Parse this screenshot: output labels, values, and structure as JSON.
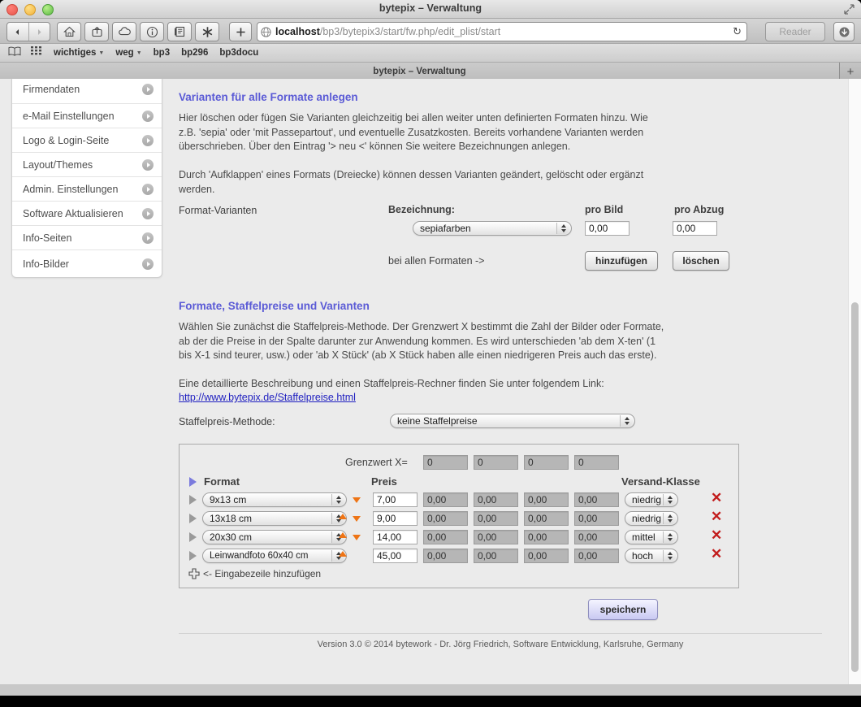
{
  "window": {
    "title": "bytepix – Verwaltung",
    "traffic_lights": [
      "close",
      "minimize",
      "zoom"
    ],
    "expand_icon": "expand-arrows-icon"
  },
  "toolbar": {
    "back_icon": "back-arrow-icon",
    "forward_icon": "forward-arrow-icon",
    "home_icon": "home-icon",
    "share_icon": "share-icon",
    "icloud_icon": "cloud-icon",
    "info_icon": "info-circle-icon",
    "reading_list_icon": "reading-list-icon",
    "extensions_icon": "asterisk-icon",
    "add_icon": "plus-icon",
    "url_prefix": "localhost",
    "url_path": "/bp3/bytepix3/start/fw.php/edit_plist/start",
    "reload_icon": "reload-icon",
    "reader_label": "Reader",
    "download_icon": "download-icon"
  },
  "bookmarks": {
    "sidebar_icon": "book-icon",
    "topsites_icon": "grid-icon",
    "items": [
      {
        "label": "wichtiges",
        "has_menu": true
      },
      {
        "label": "weg",
        "has_menu": true
      },
      {
        "label": "bp3",
        "has_menu": false
      },
      {
        "label": "bp296",
        "has_menu": false
      },
      {
        "label": "bp3docu",
        "has_menu": false
      }
    ]
  },
  "tabs": {
    "active_label": "bytepix – Verwaltung",
    "new_tab_icon": "plus-icon"
  },
  "sidebar": {
    "items": [
      {
        "label": "Firmendaten"
      },
      {
        "label": "e-Mail Einstellungen"
      },
      {
        "label": "Logo & Login-Seite"
      },
      {
        "label": "Layout/Themes"
      },
      {
        "label": "Admin. Einstellungen"
      },
      {
        "label": "Software Aktualisieren"
      },
      {
        "label": "Info-Seiten"
      },
      {
        "label": "Info-Bilder"
      }
    ]
  },
  "variants_section": {
    "heading": "Varianten für alle Formate anlegen",
    "paragraph1": "Hier löschen oder fügen Sie Varianten gleichzeitig bei allen weiter unten definierten Formaten hinzu. Wie z.B. 'sepia' oder 'mit Passepartout', und eventuelle Zusatzkosten. Bereits vorhandene Varianten werden überschrieben. Über den Eintrag '> neu <' können Sie weitere Bezeichnungen anlegen.",
    "paragraph2": "Durch 'Aufklappen' eines Formats (Dreiecke) können dessen Varianten geändert, gelöscht oder ergänzt werden.",
    "row_label": "Format-Varianten",
    "bezeichnung_label": "Bezeichnung:",
    "bezeichnung_value": "sepiafarben",
    "pro_bild_label": "pro Bild",
    "pro_bild_value": "0,00",
    "pro_abzug_label": "pro Abzug",
    "pro_abzug_value": "0,00",
    "apply_label": "bei allen Formaten ->",
    "add_button": "hinzufügen",
    "delete_button": "löschen"
  },
  "formats_section": {
    "heading": "Formate, Staffelpreise und Varianten",
    "paragraph1": "Wählen Sie zunächst die Staffelpreis-Methode. Der Grenzwert X bestimmt die Zahl der Bilder oder Formate, ab der die Preise in der Spalte darunter zur Anwendung kommen. Es wird unterschieden 'ab dem X-ten' (1 bis X-1 sind teurer, usw.) oder 'ab X Stück' (ab X Stück haben alle einen niedrigeren Preis auch das erste).",
    "paragraph2": "Eine detaillierte Beschreibung und einen Staffelpreis-Rechner finden Sie unter folgendem Link:",
    "link_text": "http://www.bytepix.de/Staffelpreise.html",
    "method_label": "Staffelpreis-Methode:",
    "method_value": "keine Staffelpreise",
    "grenzwert_label": "Grenzwert X=",
    "grenzwert_values": [
      "0",
      "0",
      "0",
      "0"
    ],
    "col_format": "Format",
    "col_preis": "Preis",
    "col_versand": "Versand-Klasse",
    "rows": [
      {
        "format": "9x13 cm",
        "price": "7,00",
        "tier_prices": [
          "0,00",
          "0,00",
          "0,00",
          "0,00"
        ],
        "shipping": "niedrig",
        "sort_up": false,
        "sort_down": true
      },
      {
        "format": "13x18 cm",
        "price": "9,00",
        "tier_prices": [
          "0,00",
          "0,00",
          "0,00",
          "0,00"
        ],
        "shipping": "niedrig",
        "sort_up": true,
        "sort_down": true
      },
      {
        "format": "20x30 cm",
        "price": "14,00",
        "tier_prices": [
          "0,00",
          "0,00",
          "0,00",
          "0,00"
        ],
        "shipping": "mittel",
        "sort_up": true,
        "sort_down": true
      },
      {
        "format": "Leinwandfoto 60x40 cm",
        "price": "45,00",
        "tier_prices": [
          "0,00",
          "0,00",
          "0,00",
          "0,00"
        ],
        "shipping": "hoch",
        "sort_up": true,
        "sort_down": false
      }
    ],
    "add_row_label": "<- Eingabezeile hinzufügen",
    "save_button": "speichern"
  },
  "footer": {
    "text": "Version 3.0 © 2014 bytework - Dr. Jörg Friedrich, Software Entwicklung, Karlsruhe, Germany"
  },
  "colors": {
    "heading": "#5b5bd6",
    "link": "#1f1fc0",
    "sort_arrow": "#ee7415",
    "delete": "#c21c1c"
  }
}
